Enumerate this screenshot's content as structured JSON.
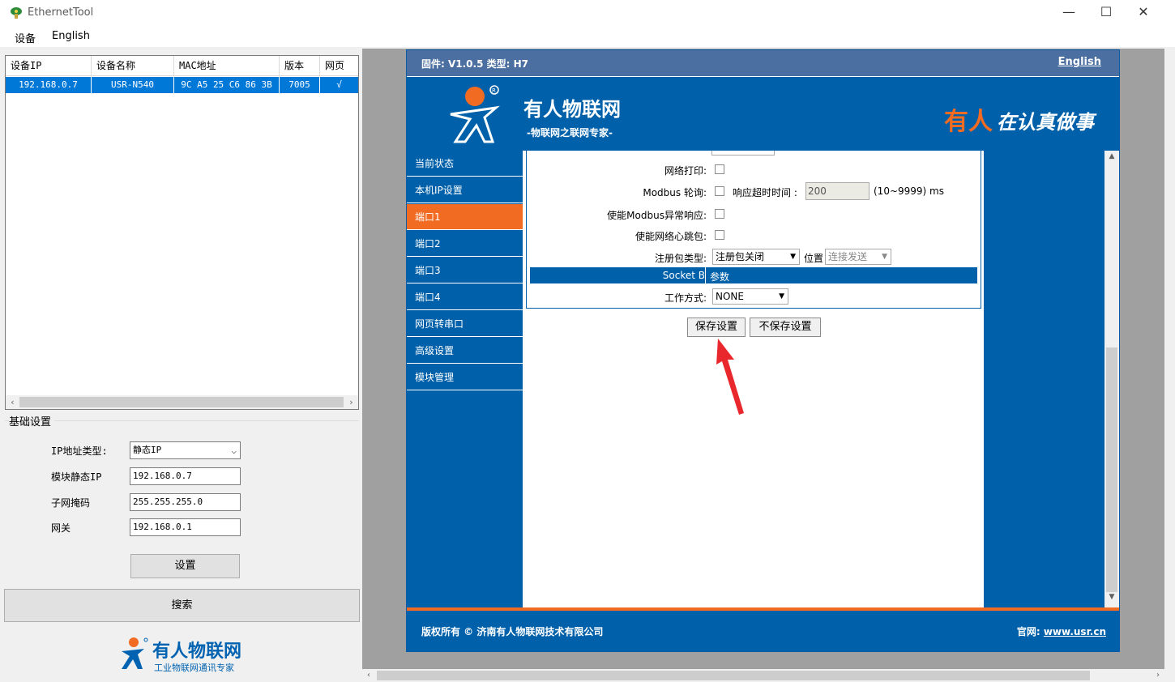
{
  "window": {
    "title": "EthernetTool",
    "min_glyph": "—",
    "max_glyph": "☐",
    "close_glyph": "✕"
  },
  "menu": {
    "device": "设备",
    "english": "English"
  },
  "device_table": {
    "headers": [
      "设备IP",
      "设备名称",
      "MAC地址",
      "版本",
      "网页"
    ],
    "rows": [
      {
        "ip": "192.168.0.7",
        "name": "USR-N540",
        "mac": "9C A5 25 C6 86 3B",
        "version": "7005",
        "web": "√"
      }
    ]
  },
  "basic_settings": {
    "group_label": "基础设置",
    "ip_type_label": "IP地址类型:",
    "ip_type_value": "静态IP",
    "static_ip_label": "模块静态IP",
    "static_ip_value": "192.168.0.7",
    "subnet_label": "子网掩码",
    "subnet_value": "255.255.255.0",
    "gateway_label": "网关",
    "gateway_value": "192.168.0.1",
    "set_button": "设置",
    "search_button": "搜索"
  },
  "logo_bottom": {
    "name": "有人物联网",
    "tagline": "工业物联网通讯专家"
  },
  "web": {
    "firmware": "固件: V1.0.5 类型: H7",
    "english_link": "English",
    "brand_name": "有人物联网",
    "brand_sub": "-物联网之联网专家-",
    "slogan_orange": "有人",
    "slogan_white": "在认真做事",
    "nav": [
      "当前状态",
      "本机IP设置",
      "端口1",
      "端口2",
      "端口3",
      "端口4",
      "网页转串口",
      "高级设置",
      "模块管理"
    ],
    "active_nav": "端口1",
    "form": {
      "net_print_label": "网络打印:",
      "modbus_poll_label": "Modbus 轮询:",
      "timeout_label": "响应超时时间 :",
      "timeout_value": "200",
      "timeout_range": "(10~9999) ms",
      "modbus_exception_label": "使能Modbus异常响应:",
      "heartbeat_label": "使能网络心跳包:",
      "reg_type_label": "注册包类型:",
      "reg_type_value": "注册包关闭",
      "position_label": "位置",
      "position_value": "连接发送",
      "socket_b_left": "Socket B",
      "socket_b_right": "参数",
      "work_mode_label": "工作方式:",
      "work_mode_value": "NONE"
    },
    "save_button": "保存设置",
    "nosave_button": "不保存设置",
    "footer_copy": "版权所有 © 济南有人物联网技术有限公司",
    "footer_site_label": "官网: ",
    "footer_site_link": "www.usr.cn"
  },
  "colors": {
    "brand_blue": "#0060a9",
    "accent_orange": "#f26b22",
    "select_blue": "#0078d7",
    "annotation_red": "#e8282c"
  }
}
